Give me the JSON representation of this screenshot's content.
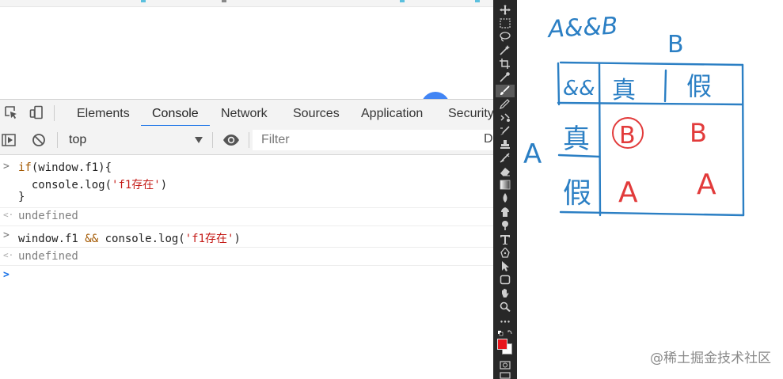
{
  "devtools": {
    "tabs": [
      {
        "label": "Elements",
        "active": false
      },
      {
        "label": "Console",
        "active": true
      },
      {
        "label": "Network",
        "active": false
      },
      {
        "label": "Sources",
        "active": false
      },
      {
        "label": "Application",
        "active": false
      },
      {
        "label": "Security",
        "active": false
      }
    ],
    "icons": [
      "inspect-element-icon",
      "device-toolbar-icon",
      "show-sidebar-icon",
      "clear-console-icon",
      "eye-icon",
      "chevron-down-icon"
    ],
    "context_select": {
      "value": "top"
    },
    "filter": {
      "placeholder": "Filter",
      "value": ""
    },
    "right_cutoff_label": "D",
    "accent_color": "#1a73e8"
  },
  "console": {
    "entry1": {
      "line1": {
        "kw": "if",
        "a": "(window.f1){"
      },
      "line2": {
        "a": "  console.log(",
        "str": "'f1存在'",
        "b": ")"
      },
      "line3": "}",
      "result": "undefined"
    },
    "entry2": {
      "a": "window.f1 ",
      "op": "&&",
      "b": " console.log(",
      "str": "'f1存在'",
      "c": ")",
      "result": "undefined"
    },
    "prompt_symbols": {
      "input": ">",
      "output": "<·",
      "active": ">"
    }
  },
  "photoshop_tools": {
    "icons": [
      "move-tool-icon",
      "marquee-tool-icon",
      "lasso-tool-icon",
      "magic-wand-tool-icon",
      "crop-tool-icon",
      "eyedropper-tool-icon",
      "brush-tool-icon",
      "pencil-tool-icon",
      "clone-stamp-tool-icon",
      "history-brush-tool-icon",
      "stamp-tool-icon",
      "healing-tool-icon",
      "eraser-tool-icon",
      "gradient-tool-icon",
      "blur-tool-icon",
      "smudge-tool-icon",
      "dodge-tool-icon",
      "type-tool-icon",
      "pen-tool-icon",
      "path-selection-tool-icon",
      "rectangle-tool-icon",
      "hand-tool-icon",
      "zoom-tool-icon",
      "more-tools-icon",
      "default-colors-icon",
      "color-swatch-icon",
      "quick-mask-icon",
      "screen-mode-icon"
    ],
    "selected_tool": "brush-tool-icon",
    "foreground_color": "#e8141b",
    "background_color": "#ffffff"
  },
  "drawing": {
    "title": "A&&B",
    "col_header": "B",
    "row_header": "A",
    "table": {
      "corner": "&&",
      "col_labels": [
        "真",
        "假"
      ],
      "rows": [
        {
          "label": "真",
          "cells": [
            "B",
            "B"
          ]
        },
        {
          "label": "假",
          "cells": [
            "A",
            "A"
          ]
        }
      ]
    },
    "ink_blue": "#2b7fc4",
    "ink_red": "#e23b3b"
  },
  "watermark": "@稀土掘金技术社区"
}
